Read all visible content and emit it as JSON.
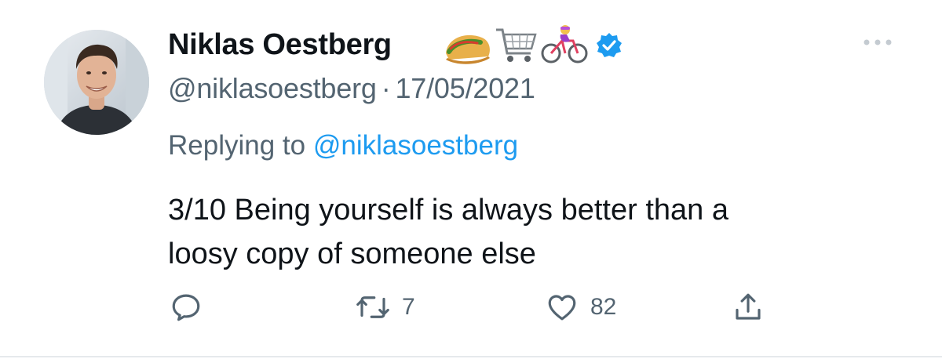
{
  "user": {
    "display_name": "Niklas Oestberg",
    "handle": "@niklasoestberg",
    "date": "17/05/2021",
    "separator": "·",
    "verified": true,
    "name_emojis": [
      "taco-icon",
      "shopping-cart-icon",
      "woman-biking-icon",
      "verified-badge-icon"
    ]
  },
  "reply": {
    "prefix": "Replying to",
    "mention": "@niklasoestberg"
  },
  "tweet": {
    "text_line1": "3/10 Being yourself is always better than a",
    "text_line2": "loosy copy of someone else"
  },
  "actions": {
    "reply_icon": "reply-icon",
    "retweet_count": "7",
    "like_count": "82",
    "share_icon": "share-icon"
  },
  "colors": {
    "accent": "#1d9bf0",
    "secondary_text": "#536471",
    "primary_text": "#0f1419"
  }
}
